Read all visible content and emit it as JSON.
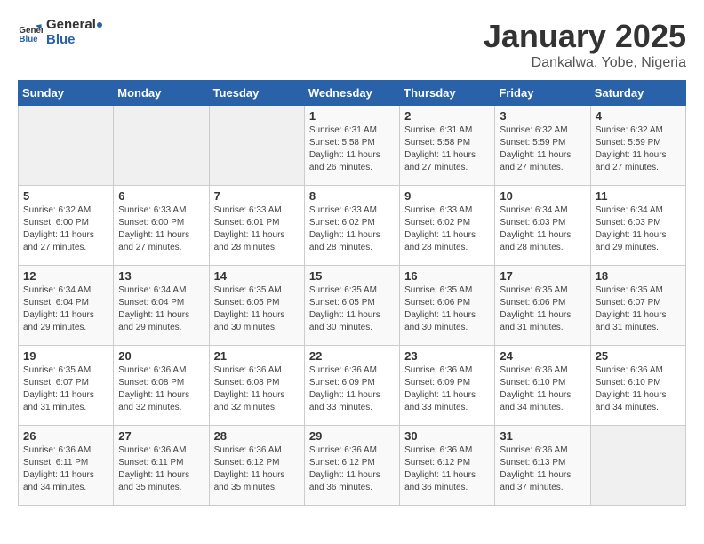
{
  "header": {
    "logo_general": "General",
    "logo_blue": "Blue",
    "title": "January 2025",
    "subtitle": "Dankalwa, Yobe, Nigeria"
  },
  "days_of_week": [
    "Sunday",
    "Monday",
    "Tuesday",
    "Wednesday",
    "Thursday",
    "Friday",
    "Saturday"
  ],
  "weeks": [
    [
      {
        "day": "",
        "sunrise": "",
        "sunset": "",
        "daylight": "",
        "empty": true
      },
      {
        "day": "",
        "sunrise": "",
        "sunset": "",
        "daylight": "",
        "empty": true
      },
      {
        "day": "",
        "sunrise": "",
        "sunset": "",
        "daylight": "",
        "empty": true
      },
      {
        "day": "1",
        "sunrise": "Sunrise: 6:31 AM",
        "sunset": "Sunset: 5:58 PM",
        "daylight": "Daylight: 11 hours and 26 minutes."
      },
      {
        "day": "2",
        "sunrise": "Sunrise: 6:31 AM",
        "sunset": "Sunset: 5:58 PM",
        "daylight": "Daylight: 11 hours and 27 minutes."
      },
      {
        "day": "3",
        "sunrise": "Sunrise: 6:32 AM",
        "sunset": "Sunset: 5:59 PM",
        "daylight": "Daylight: 11 hours and 27 minutes."
      },
      {
        "day": "4",
        "sunrise": "Sunrise: 6:32 AM",
        "sunset": "Sunset: 5:59 PM",
        "daylight": "Daylight: 11 hours and 27 minutes."
      }
    ],
    [
      {
        "day": "5",
        "sunrise": "Sunrise: 6:32 AM",
        "sunset": "Sunset: 6:00 PM",
        "daylight": "Daylight: 11 hours and 27 minutes."
      },
      {
        "day": "6",
        "sunrise": "Sunrise: 6:33 AM",
        "sunset": "Sunset: 6:00 PM",
        "daylight": "Daylight: 11 hours and 27 minutes."
      },
      {
        "day": "7",
        "sunrise": "Sunrise: 6:33 AM",
        "sunset": "Sunset: 6:01 PM",
        "daylight": "Daylight: 11 hours and 28 minutes."
      },
      {
        "day": "8",
        "sunrise": "Sunrise: 6:33 AM",
        "sunset": "Sunset: 6:02 PM",
        "daylight": "Daylight: 11 hours and 28 minutes."
      },
      {
        "day": "9",
        "sunrise": "Sunrise: 6:33 AM",
        "sunset": "Sunset: 6:02 PM",
        "daylight": "Daylight: 11 hours and 28 minutes."
      },
      {
        "day": "10",
        "sunrise": "Sunrise: 6:34 AM",
        "sunset": "Sunset: 6:03 PM",
        "daylight": "Daylight: 11 hours and 28 minutes."
      },
      {
        "day": "11",
        "sunrise": "Sunrise: 6:34 AM",
        "sunset": "Sunset: 6:03 PM",
        "daylight": "Daylight: 11 hours and 29 minutes."
      }
    ],
    [
      {
        "day": "12",
        "sunrise": "Sunrise: 6:34 AM",
        "sunset": "Sunset: 6:04 PM",
        "daylight": "Daylight: 11 hours and 29 minutes."
      },
      {
        "day": "13",
        "sunrise": "Sunrise: 6:34 AM",
        "sunset": "Sunset: 6:04 PM",
        "daylight": "Daylight: 11 hours and 29 minutes."
      },
      {
        "day": "14",
        "sunrise": "Sunrise: 6:35 AM",
        "sunset": "Sunset: 6:05 PM",
        "daylight": "Daylight: 11 hours and 30 minutes."
      },
      {
        "day": "15",
        "sunrise": "Sunrise: 6:35 AM",
        "sunset": "Sunset: 6:05 PM",
        "daylight": "Daylight: 11 hours and 30 minutes."
      },
      {
        "day": "16",
        "sunrise": "Sunrise: 6:35 AM",
        "sunset": "Sunset: 6:06 PM",
        "daylight": "Daylight: 11 hours and 30 minutes."
      },
      {
        "day": "17",
        "sunrise": "Sunrise: 6:35 AM",
        "sunset": "Sunset: 6:06 PM",
        "daylight": "Daylight: 11 hours and 31 minutes."
      },
      {
        "day": "18",
        "sunrise": "Sunrise: 6:35 AM",
        "sunset": "Sunset: 6:07 PM",
        "daylight": "Daylight: 11 hours and 31 minutes."
      }
    ],
    [
      {
        "day": "19",
        "sunrise": "Sunrise: 6:35 AM",
        "sunset": "Sunset: 6:07 PM",
        "daylight": "Daylight: 11 hours and 31 minutes."
      },
      {
        "day": "20",
        "sunrise": "Sunrise: 6:36 AM",
        "sunset": "Sunset: 6:08 PM",
        "daylight": "Daylight: 11 hours and 32 minutes."
      },
      {
        "day": "21",
        "sunrise": "Sunrise: 6:36 AM",
        "sunset": "Sunset: 6:08 PM",
        "daylight": "Daylight: 11 hours and 32 minutes."
      },
      {
        "day": "22",
        "sunrise": "Sunrise: 6:36 AM",
        "sunset": "Sunset: 6:09 PM",
        "daylight": "Daylight: 11 hours and 33 minutes."
      },
      {
        "day": "23",
        "sunrise": "Sunrise: 6:36 AM",
        "sunset": "Sunset: 6:09 PM",
        "daylight": "Daylight: 11 hours and 33 minutes."
      },
      {
        "day": "24",
        "sunrise": "Sunrise: 6:36 AM",
        "sunset": "Sunset: 6:10 PM",
        "daylight": "Daylight: 11 hours and 34 minutes."
      },
      {
        "day": "25",
        "sunrise": "Sunrise: 6:36 AM",
        "sunset": "Sunset: 6:10 PM",
        "daylight": "Daylight: 11 hours and 34 minutes."
      }
    ],
    [
      {
        "day": "26",
        "sunrise": "Sunrise: 6:36 AM",
        "sunset": "Sunset: 6:11 PM",
        "daylight": "Daylight: 11 hours and 34 minutes."
      },
      {
        "day": "27",
        "sunrise": "Sunrise: 6:36 AM",
        "sunset": "Sunset: 6:11 PM",
        "daylight": "Daylight: 11 hours and 35 minutes."
      },
      {
        "day": "28",
        "sunrise": "Sunrise: 6:36 AM",
        "sunset": "Sunset: 6:12 PM",
        "daylight": "Daylight: 11 hours and 35 minutes."
      },
      {
        "day": "29",
        "sunrise": "Sunrise: 6:36 AM",
        "sunset": "Sunset: 6:12 PM",
        "daylight": "Daylight: 11 hours and 36 minutes."
      },
      {
        "day": "30",
        "sunrise": "Sunrise: 6:36 AM",
        "sunset": "Sunset: 6:12 PM",
        "daylight": "Daylight: 11 hours and 36 minutes."
      },
      {
        "day": "31",
        "sunrise": "Sunrise: 6:36 AM",
        "sunset": "Sunset: 6:13 PM",
        "daylight": "Daylight: 11 hours and 37 minutes."
      },
      {
        "day": "",
        "sunrise": "",
        "sunset": "",
        "daylight": "",
        "empty": true
      }
    ]
  ]
}
